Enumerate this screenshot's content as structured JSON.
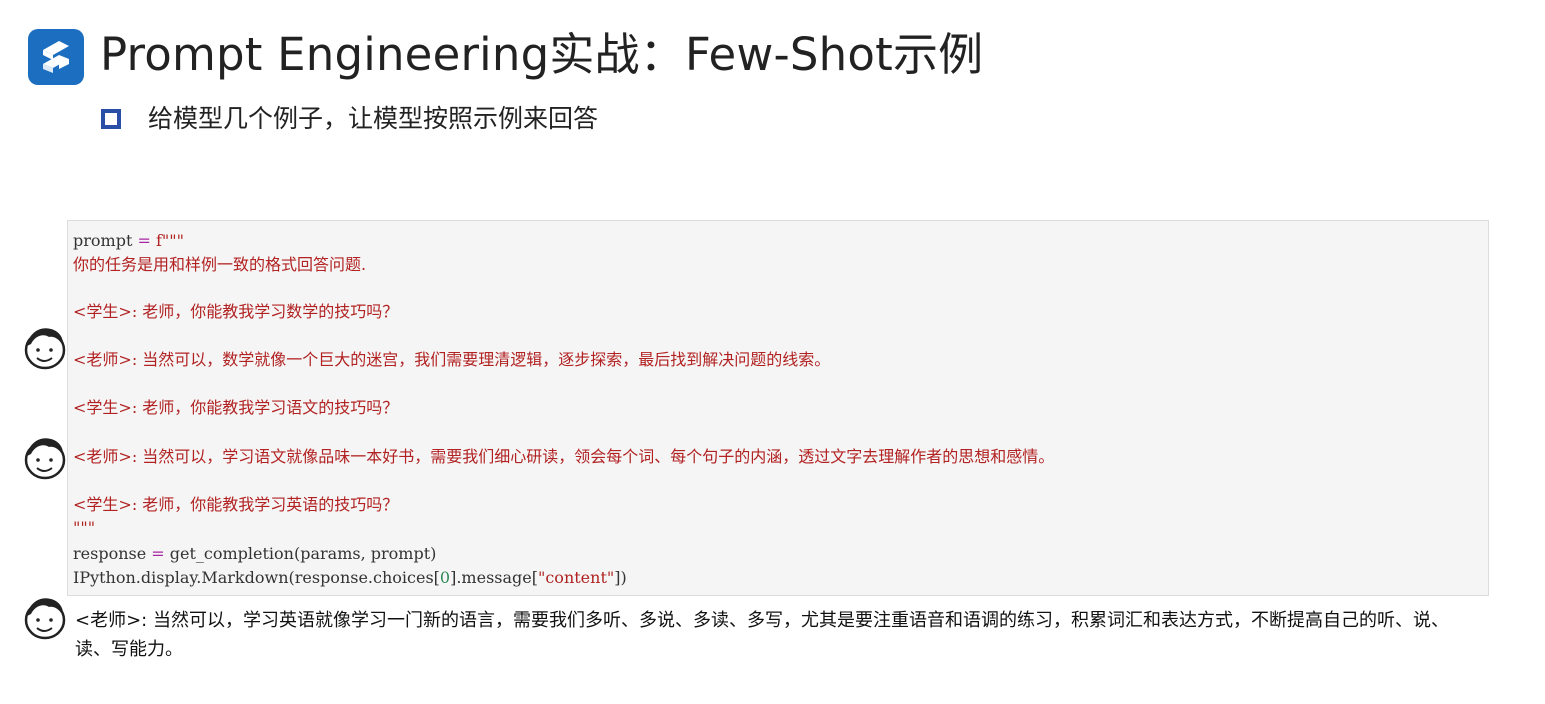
{
  "header": {
    "logo_icon": "brand-logo-icon",
    "title": "Prompt Engineering实战：Few-Shot示例",
    "bullet_text": "给模型几个例子，让模型按照示例来回答"
  },
  "code": {
    "line_prompt_var": "prompt",
    "line_prompt_eq": " = ",
    "line_prompt_str": "f\"\"\"",
    "task": "你的任务是用和样例一致的格式回答问题.",
    "q1": "<学生>: 老师，你能教我学习数学的技巧吗？",
    "a1": "<老师>: 当然可以，数学就像一个巨大的迷宫，我们需要理清逻辑，逐步探索，最后找到解决问题的线索。",
    "q2": "<学生>: 老师，你能教我学习语文的技巧吗？",
    "a2": "<老师>: 当然可以，学习语文就像品味一本好书，需要我们细心研读，领会每个词、每个句子的内涵，透过文字去理解作者的思想和感情。",
    "q3": "<学生>: 老师，你能教我学习英语的技巧吗？",
    "close_quote": "\"\"\"",
    "resp_var": "response",
    "resp_eq": " = ",
    "resp_call": "get_completion(params, prompt)",
    "display_a": "IPython.display.Markdown(response.choices[",
    "display_idx": "0",
    "display_b": "].message[",
    "display_key": "\"content\"",
    "display_c": "])"
  },
  "output": {
    "text": "<老师>: 当然可以，学习英语就像学习一门新的语言，需要我们多听、多说、多读、多写，尤其是要注重语音和语调的练习，积累词汇和表达方式，不断提高自己的听、说、读、写能力。"
  },
  "colors": {
    "brand": "#1c6fc0",
    "bullet": "#2a4ea8",
    "string": "#b22222",
    "operator": "#a626a4",
    "number": "#2e8b57"
  },
  "icons": [
    "brand-logo-icon",
    "square-bullet-icon",
    "smiley-face-icon"
  ]
}
